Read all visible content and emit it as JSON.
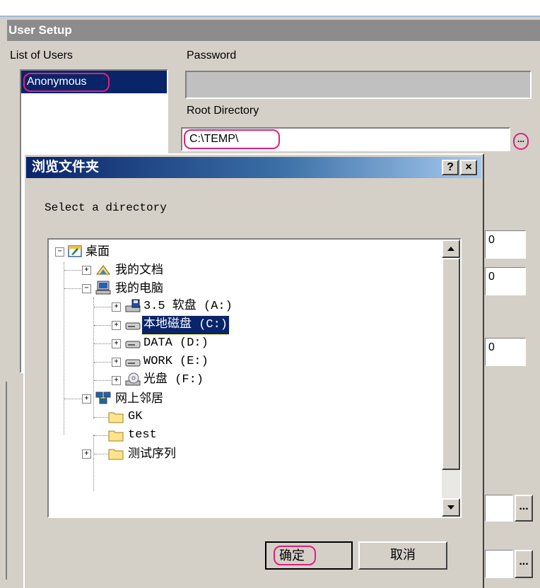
{
  "user_setup": {
    "header": "User Setup",
    "list_of_users_label": "List of Users",
    "users": [
      "Anonymous"
    ],
    "password_label": "Password",
    "password_value": "",
    "root_directory_label": "Root Directory",
    "root_directory_value": "C:\\TEMP\\",
    "browse_label": "...",
    "numeric_fields": [
      "0",
      "0",
      "0"
    ],
    "extra_browse_labels": [
      "...",
      "..."
    ]
  },
  "dialog": {
    "title": "浏览文件夹",
    "help_label": "?",
    "close_label": "×",
    "prompt": "Select a directory",
    "ok_label": "确定",
    "cancel_label": "取消",
    "tree": [
      {
        "label": "桌面",
        "icon": "desktop-icon",
        "expander": "−"
      },
      {
        "label": "我的文档",
        "icon": "my-documents-icon",
        "expander": "+"
      },
      {
        "label": "我的电脑",
        "icon": "my-computer-icon",
        "expander": "−"
      },
      {
        "label": "3.5 软盘 (A:)",
        "icon": "floppy-drive-icon",
        "expander": "+"
      },
      {
        "label": "本地磁盘 (C:)",
        "icon": "hard-drive-icon",
        "expander": "+",
        "selected": true
      },
      {
        "label": "DATA (D:)",
        "icon": "hard-drive-icon",
        "expander": "+"
      },
      {
        "label": "WORK (E:)",
        "icon": "hard-drive-icon",
        "expander": "+"
      },
      {
        "label": "光盘 (F:)",
        "icon": "cd-drive-icon",
        "expander": "+"
      },
      {
        "label": "网上邻居",
        "icon": "network-icon",
        "expander": "+"
      },
      {
        "label": "GK",
        "icon": "folder-icon",
        "expander": ""
      },
      {
        "label": "test",
        "icon": "folder-icon",
        "expander": ""
      },
      {
        "label": "测试序列",
        "icon": "folder-icon",
        "expander": "+"
      }
    ]
  },
  "colors": {
    "title_bar_start": "#0a246a",
    "title_bar_end": "#a6caf0",
    "selection": "#0a246a",
    "annotation_ring": "#e0207a"
  }
}
